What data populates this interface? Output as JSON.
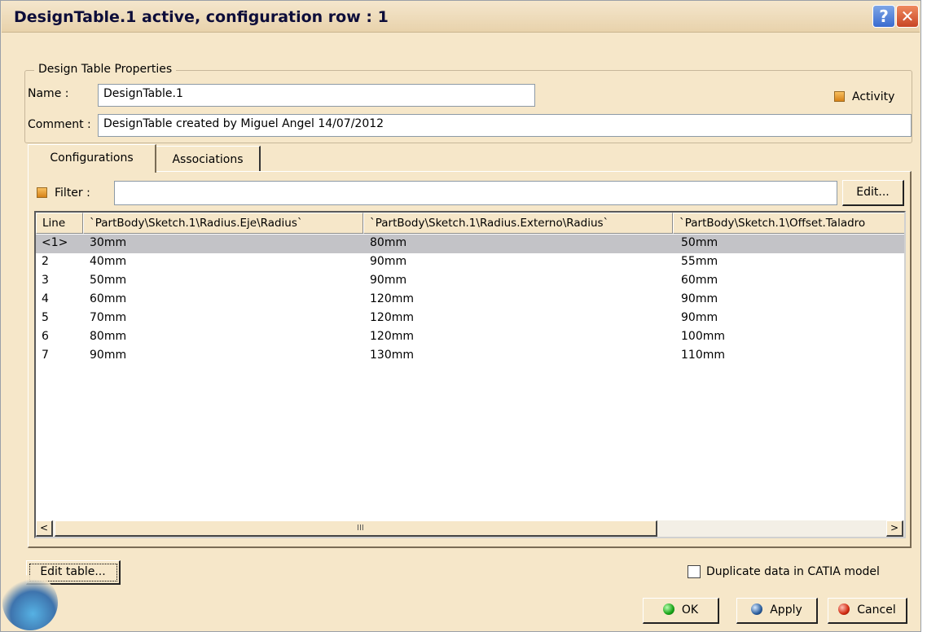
{
  "window": {
    "title": "DesignTable.1 active, configuration row : 1"
  },
  "titlebar": {
    "help_label": "?",
    "close_label": "✕"
  },
  "properties": {
    "group_label": "Design Table Properties",
    "name_label": "Name :",
    "name_value": "DesignTable.1",
    "comment_label": "Comment :",
    "comment_value": "DesignTable created by Miguel Angel 14/07/2012",
    "activity_label": "Activity"
  },
  "tabs": [
    {
      "label": "Configurations",
      "active": true
    },
    {
      "label": "Associations",
      "active": false
    }
  ],
  "filter": {
    "label": "Filter :",
    "value": "",
    "edit_button": "Edit..."
  },
  "table": {
    "columns": [
      "Line",
      "`PartBody\\Sketch.1\\Radius.Eje\\Radius`",
      "`PartBody\\Sketch.1\\Radius.Externo\\Radius`",
      "`PartBody\\Sketch.1\\Offset.Taladro"
    ],
    "rows": [
      [
        "<1>",
        "30mm",
        "80mm",
        "50mm"
      ],
      [
        "2",
        "40mm",
        "90mm",
        "55mm"
      ],
      [
        "3",
        "50mm",
        "90mm",
        "60mm"
      ],
      [
        "4",
        "60mm",
        "120mm",
        "90mm"
      ],
      [
        "5",
        "70mm",
        "120mm",
        "90mm"
      ],
      [
        "6",
        "80mm",
        "120mm",
        "100mm"
      ],
      [
        "7",
        "90mm",
        "130mm",
        "110mm"
      ]
    ],
    "selected_row": 0
  },
  "scrollbar": {
    "left_arrow": "<",
    "right_arrow": ">",
    "grip": "III"
  },
  "footer": {
    "edit_table_button": "Edit table...",
    "duplicate_label": "Duplicate data in CATIA model",
    "duplicate_checked": false,
    "ok_button": "OK",
    "apply_button": "Apply",
    "cancel_button": "Cancel"
  },
  "colors": {
    "dialog_background": "#f6e7c9",
    "selected_row": "#c3c3c7",
    "title_text": "#0d0d3a"
  }
}
